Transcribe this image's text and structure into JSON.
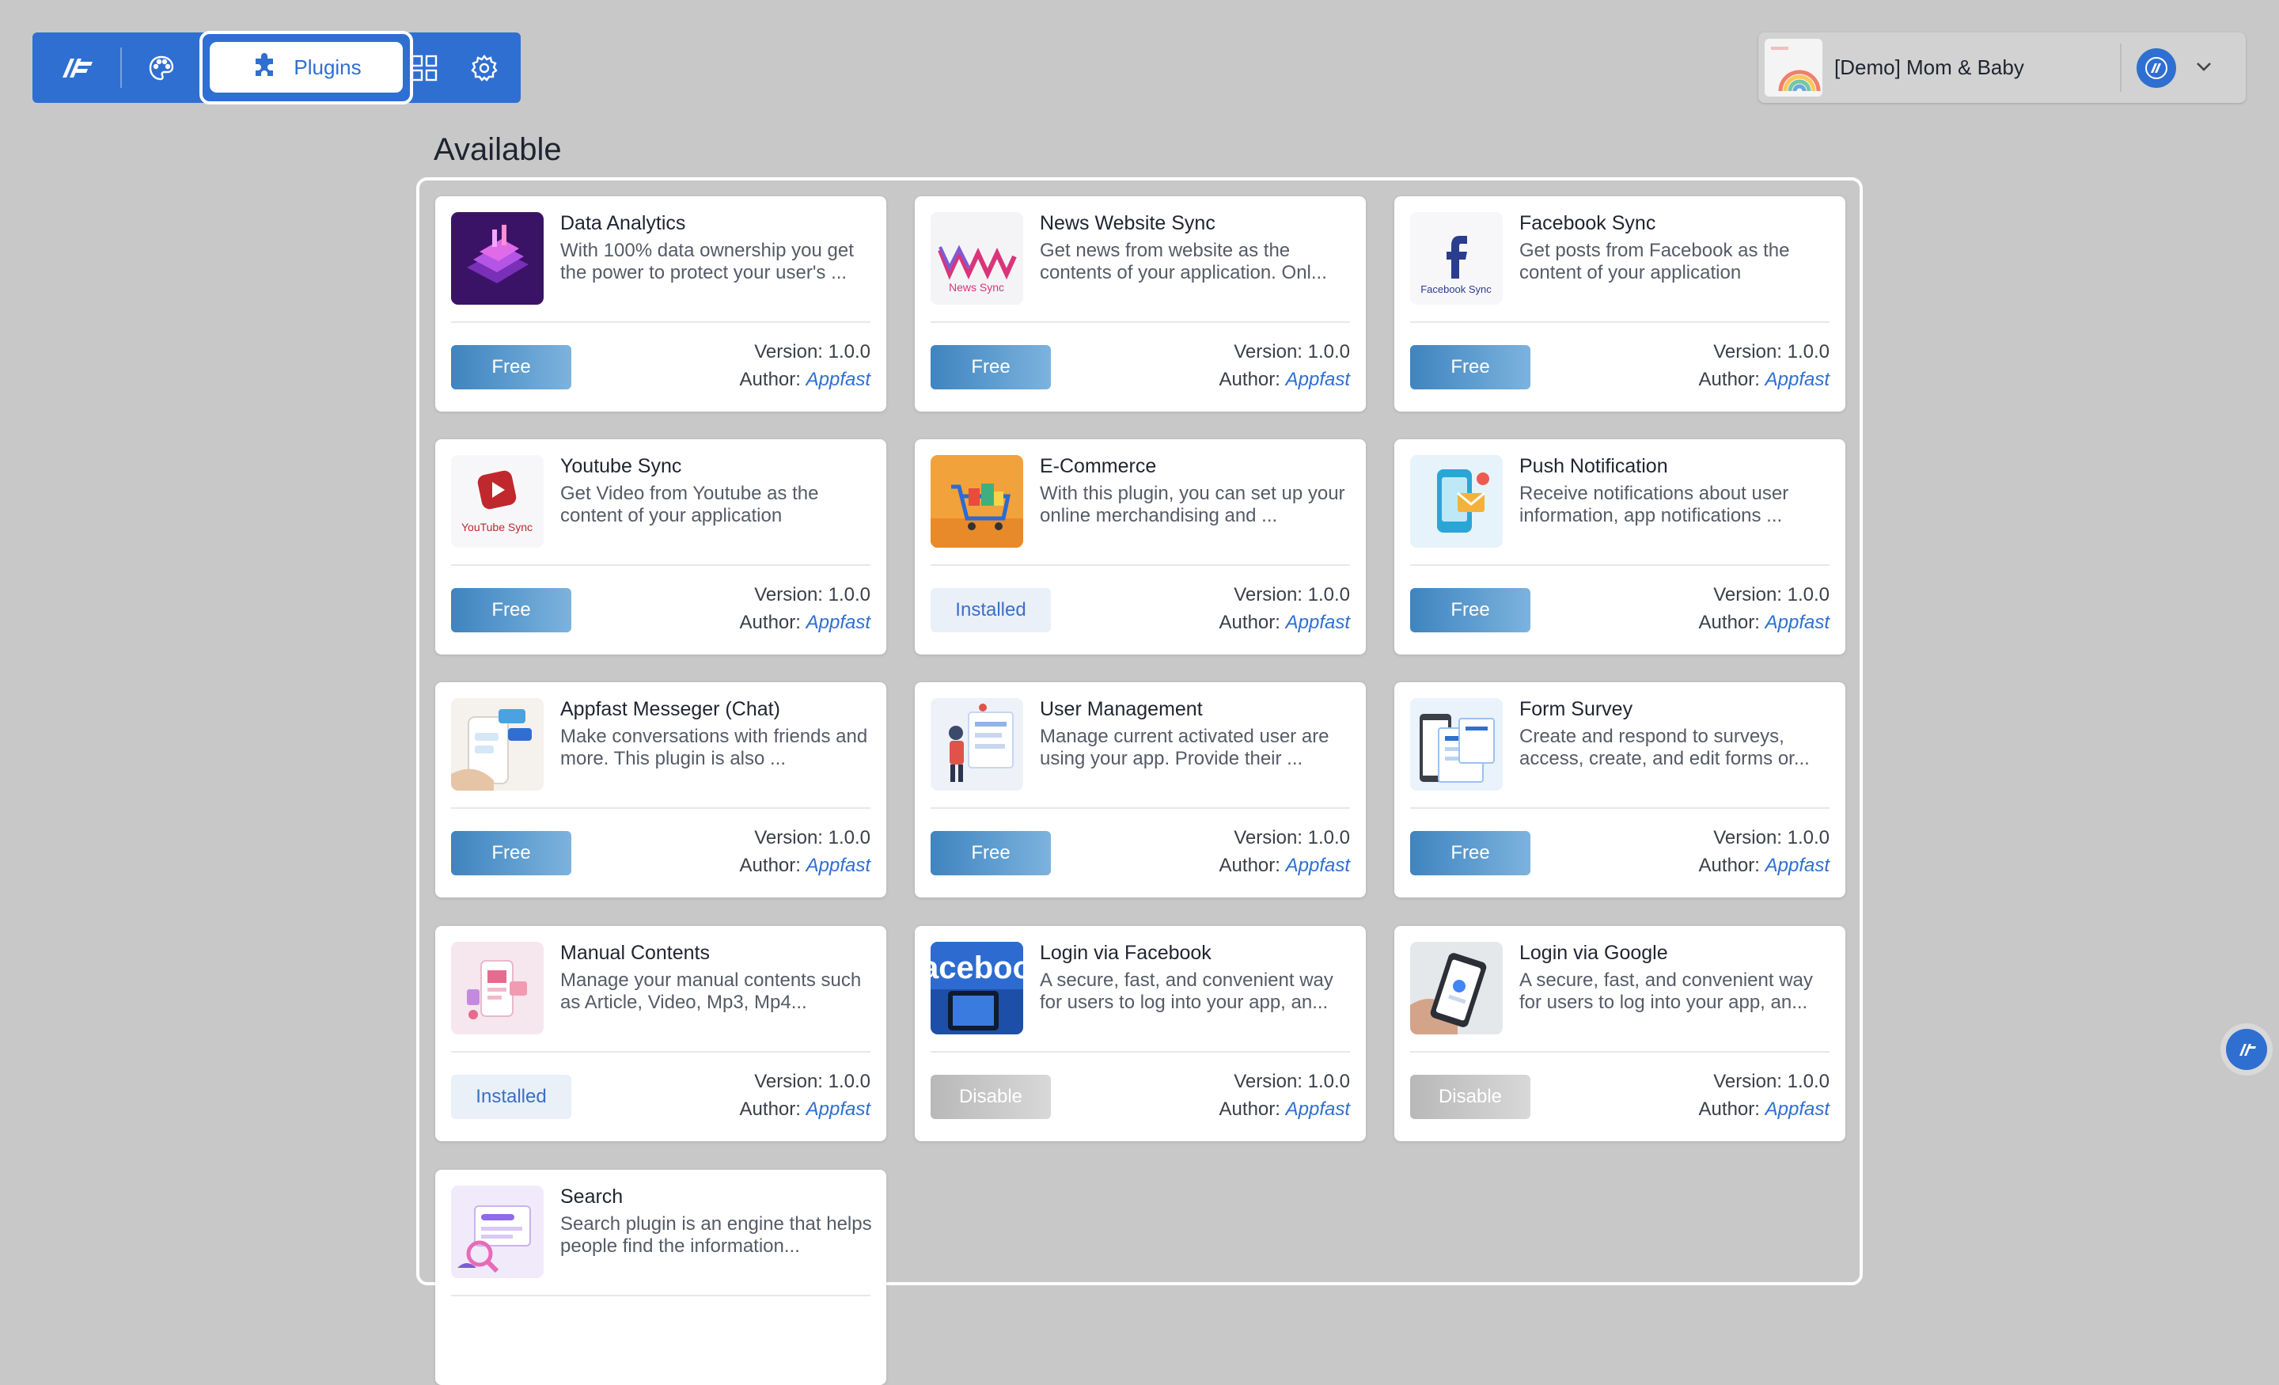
{
  "toolbar": {
    "plugins_label": "Plugins"
  },
  "project": {
    "name": "[Demo] Mom & Baby"
  },
  "section": {
    "title": "Available"
  },
  "plugins": [
    {
      "title": "Data Analytics",
      "description": "With 100% data ownership you get the power to protect your user's ...",
      "button": "Free",
      "version": "Version: 1.0.0",
      "author_label": "Author:",
      "author": "Appfast",
      "icon": "data-analytics-icon"
    },
    {
      "title": "News Website Sync",
      "description": "Get news from website as the contents of your application. Onl...",
      "button": "Free",
      "version": "Version: 1.0.0",
      "author_label": "Author:",
      "author": "Appfast",
      "icon": "news-sync-icon",
      "icon_text": "News Sync"
    },
    {
      "title": "Facebook Sync",
      "description": "Get posts from Facebook as the content of your application",
      "button": "Free",
      "version": "Version: 1.0.0",
      "author_label": "Author:",
      "author": "Appfast",
      "icon": "facebook-sync-icon",
      "icon_text": "Facebook Sync"
    },
    {
      "title": "Youtube Sync",
      "description": "Get Video from Youtube as the content of your application",
      "button": "Free",
      "version": "Version: 1.0.0",
      "author_label": "Author:",
      "author": "Appfast",
      "icon": "youtube-sync-icon",
      "icon_text": "YouTube Sync"
    },
    {
      "title": "E-Commerce",
      "description": "With this plugin, you can set up your online merchandising and ...",
      "button": "Installed",
      "version": "Version: 1.0.0",
      "author_label": "Author:",
      "author": "Appfast",
      "icon": "shopping-cart-icon"
    },
    {
      "title": "Push Notification",
      "description": "Receive notifications about user information, app notifications ...",
      "button": "Free",
      "version": "Version: 1.0.0",
      "author_label": "Author:",
      "author": "Appfast",
      "icon": "push-notification-icon"
    },
    {
      "title": "Appfast Messeger (Chat)",
      "description": "Make conversations with friends and more. This plugin is also ...",
      "button": "Free",
      "version": "Version: 1.0.0",
      "author_label": "Author:",
      "author": "Appfast",
      "icon": "chat-icon"
    },
    {
      "title": "User Management",
      "description": "Manage current activated user are using your app. Provide their ...",
      "button": "Free",
      "version": "Version: 1.0.0",
      "author_label": "Author:",
      "author": "Appfast",
      "icon": "user-management-icon"
    },
    {
      "title": "Form Survey",
      "description": "Create and respond to surveys, access, create, and edit forms or...",
      "button": "Free",
      "version": "Version: 1.0.0",
      "author_label": "Author:",
      "author": "Appfast",
      "icon": "form-survey-icon"
    },
    {
      "title": "Manual Contents",
      "description": "Manage your manual contents such as Article, Video, Mp3, Mp4...",
      "button": "Installed",
      "version": "Version: 1.0.0",
      "author_label": "Author:",
      "author": "Appfast",
      "icon": "manual-contents-icon"
    },
    {
      "title": "Login via Facebook",
      "description": "A secure, fast, and convenient way for users to log into your app, an...",
      "button": "Disable",
      "version": "Version: 1.0.0",
      "author_label": "Author:",
      "author": "Appfast",
      "icon": "facebook-login-icon",
      "icon_text": "aceboo"
    },
    {
      "title": "Login via Google",
      "description": "A secure, fast, and convenient way for users to log into your app, an...",
      "button": "Disable",
      "version": "Version: 1.0.0",
      "author_label": "Author:",
      "author": "Appfast",
      "icon": "google-login-icon"
    },
    {
      "title": "Search",
      "description": "Search plugin is an engine that helps people find the information...",
      "button": "",
      "version": "",
      "author_label": "",
      "author": "",
      "icon": "search-plugin-icon"
    }
  ],
  "colors": {
    "accent": "#2f6fd1",
    "background": "#c8c8c8",
    "free_button": "#3e84bf",
    "installed_text": "#3b6fc4",
    "disable_button": "#b8b8b8"
  }
}
